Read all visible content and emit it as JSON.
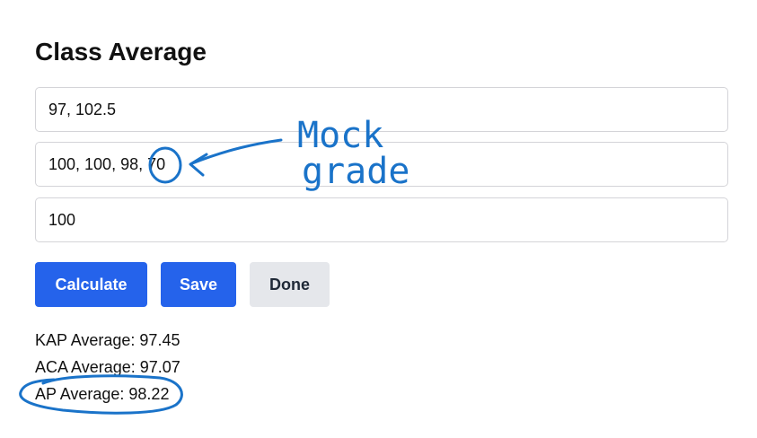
{
  "page": {
    "title": "Class Average"
  },
  "inputs": [
    {
      "value": "97, 102.5"
    },
    {
      "value": "100, 100, 98, 70"
    },
    {
      "value": "100"
    }
  ],
  "buttons": {
    "calculate": "Calculate",
    "save": "Save",
    "done": "Done"
  },
  "results": {
    "kap": "KAP Average: 97.45",
    "aca": "ACA Average: 97.07",
    "ap": "AP Average: 98.22"
  },
  "annotation": {
    "note_line1": "Mock",
    "note_line2": "grade",
    "ink_color": "#1a73c9"
  },
  "colors": {
    "primary_button": "#2563eb",
    "secondary_button": "#e5e7eb"
  }
}
